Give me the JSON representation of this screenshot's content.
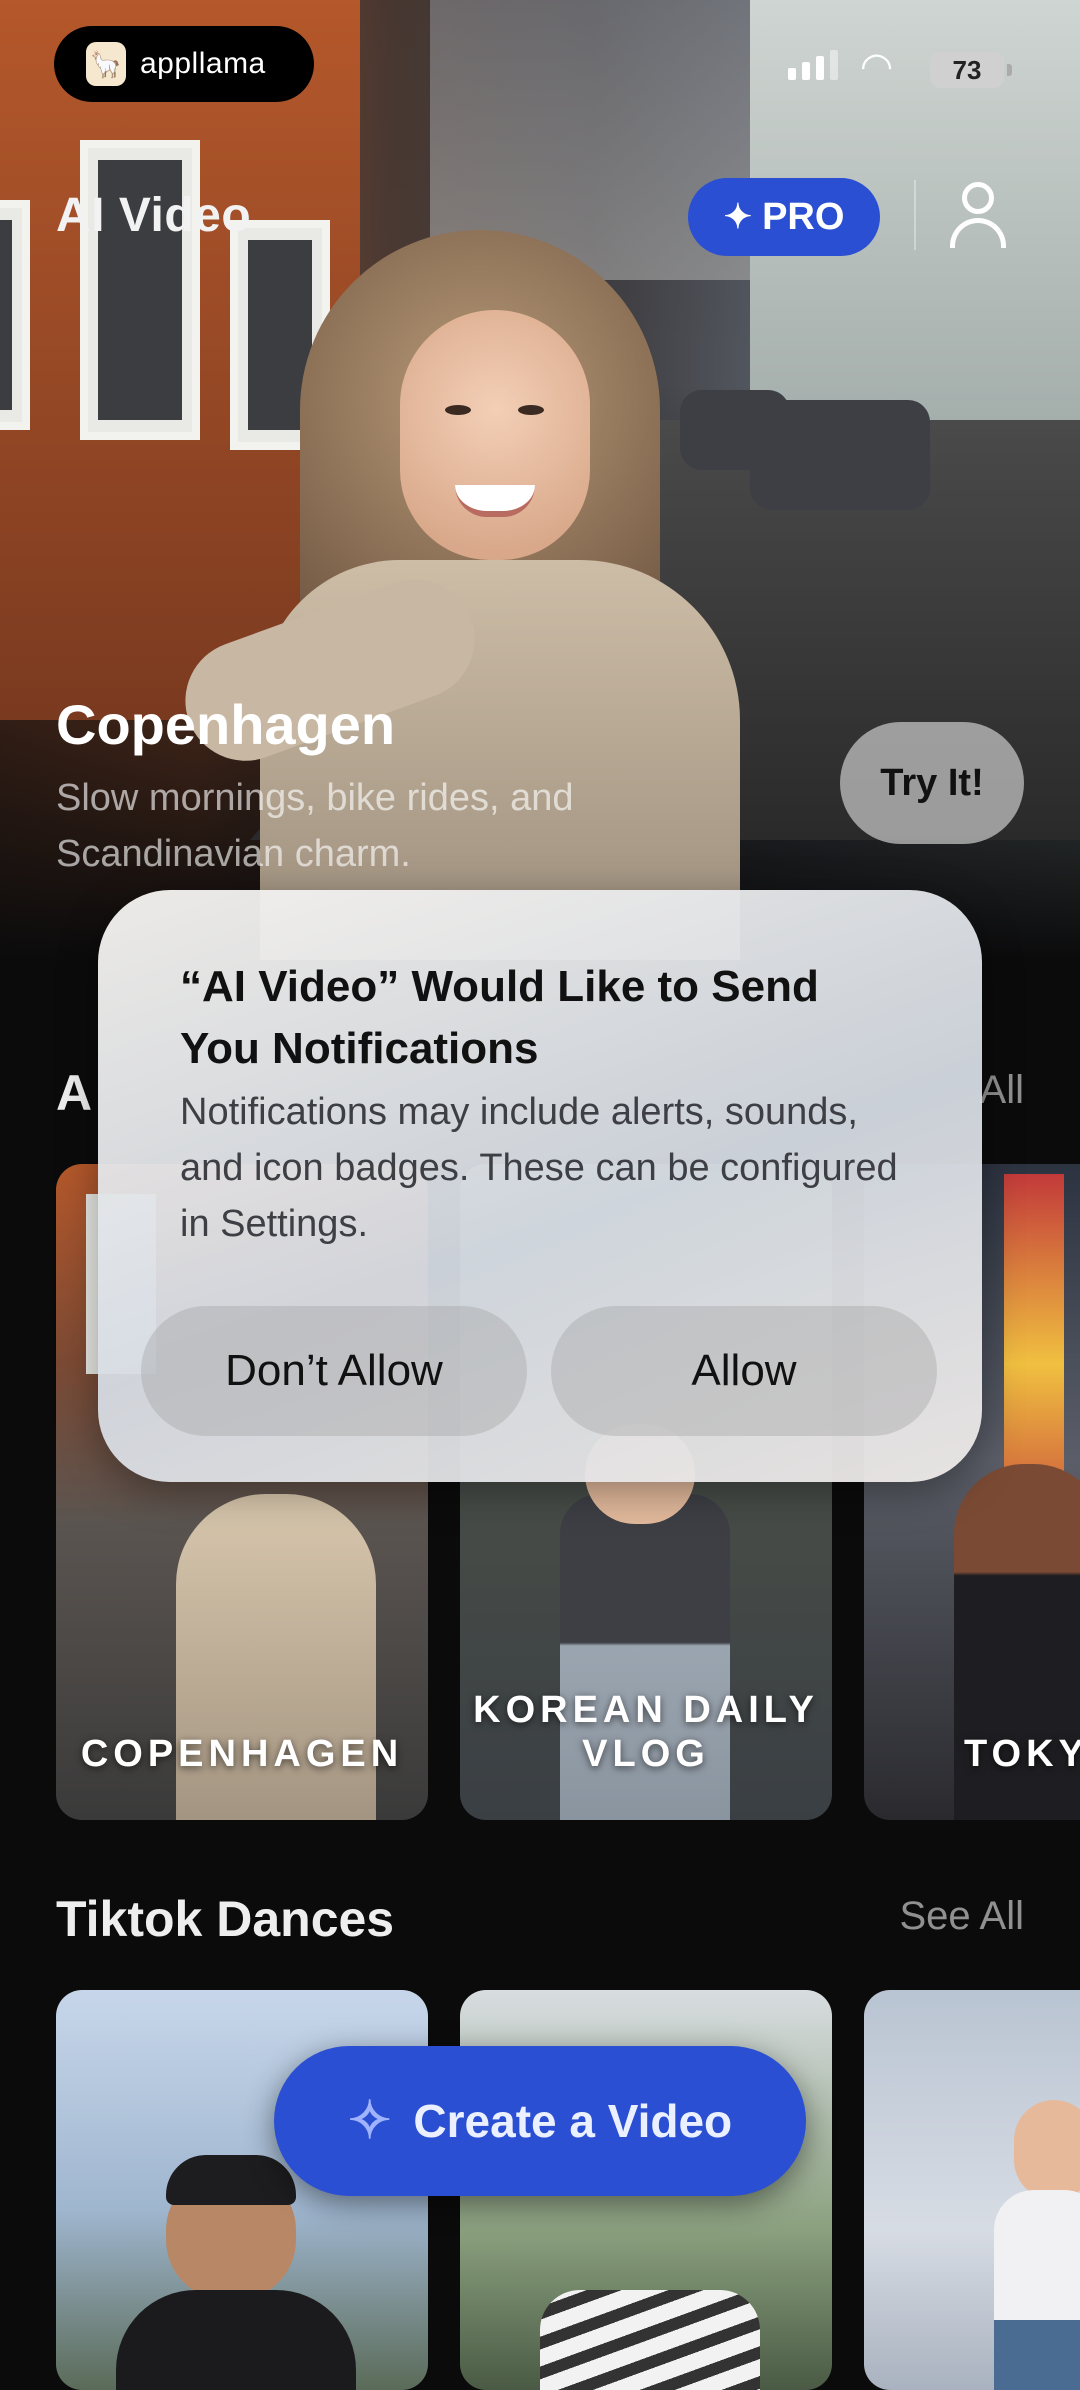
{
  "status_bar": {
    "brand": "appllama",
    "battery": "73"
  },
  "header": {
    "app_title": "AI Video",
    "pro_label": "PRO"
  },
  "hero": {
    "title": "Copenhagen",
    "subtitle": "Slow mornings, bike rides, and Scandinavian charm.",
    "try_label": "Try It!"
  },
  "section1": {
    "title_partial": "A",
    "see_all_partial": "All",
    "cards": [
      {
        "label": "COPENHAGEN"
      },
      {
        "label": "KOREAN DAILY VLOG"
      },
      {
        "label": "TOKY"
      }
    ]
  },
  "section2": {
    "title": "Tiktok Dances",
    "see_all": "See All"
  },
  "dialog": {
    "title": "“AI Video” Would Like to Send You Notifications",
    "body": "Notifications may include alerts, sounds, and icon badges. These can be configured in Settings.",
    "deny_label": "Don’t Allow",
    "allow_label": "Allow"
  },
  "create_button": {
    "label": "Create a Video"
  },
  "colors": {
    "accent_blue": "#2b4fd2",
    "background": "#0b0b0c"
  }
}
